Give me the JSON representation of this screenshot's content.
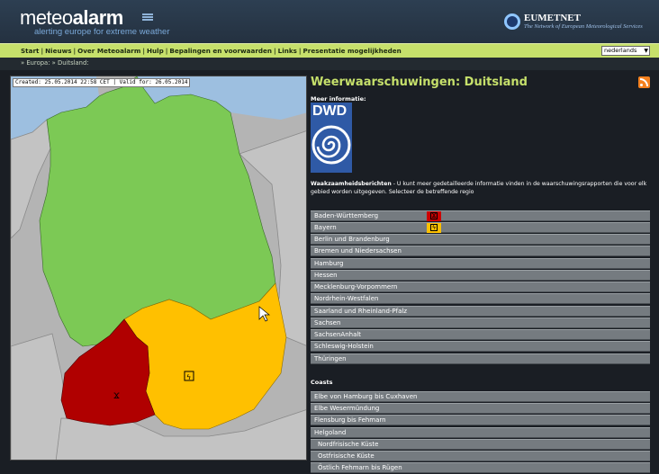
{
  "header": {
    "logo_light": "meteo",
    "logo_bold": "alarm",
    "tagline": "alerting europe for extreme weather",
    "partner_name": "EUMETNET",
    "partner_sub": "The Network of European Meteorological Services"
  },
  "nav": {
    "items": [
      {
        "label": "Start"
      },
      {
        "label": "Nieuws"
      },
      {
        "label": "Over Meteoalarm"
      },
      {
        "label": "Hulp"
      },
      {
        "label": "Bepalingen en voorwaarden"
      },
      {
        "label": "Links"
      },
      {
        "label": "Presentatie mogelijkheden"
      }
    ],
    "separator": "|",
    "language": "nederlands"
  },
  "breadcrumb": "» Europa: » Duitsland:",
  "map": {
    "caption": "Created: 25.05.2014 22:58 CET | Valid for: 26.05.2014",
    "colors": {
      "green": "#7cc955",
      "yellow": "#ffc000",
      "red": "#b00000",
      "sea": "#9dbfe0",
      "neighbor": "#c3c3c3"
    }
  },
  "main": {
    "title": "Weerwaarschuwingen: Duitsland",
    "more_info_label": "Meer informatie:",
    "dwd_label": "DWD",
    "desc_bold": "Waakzaamheidsberichten",
    "desc_text": " - U kunt meer gedetailleerde informatie vinden in de waarschuwingsrapporten die voor elk gebied worden uitgegeven. Selecteer de betreffende regio",
    "regions": [
      {
        "label": "Baden-Württemberg",
        "warning": "red"
      },
      {
        "label": "Bayern",
        "warning": "orange"
      },
      {
        "label": "Berlin und Brandenburg",
        "warning": ""
      },
      {
        "label": "Bremen und Niedersachsen",
        "warning": ""
      },
      {
        "label": "Hamburg",
        "warning": ""
      },
      {
        "label": "Hessen",
        "warning": ""
      },
      {
        "label": "Mecklenburg-Vorpommern",
        "warning": ""
      },
      {
        "label": "Nordrhein-Westfalen",
        "warning": ""
      },
      {
        "label": "Saarland und Rheinland-Pfalz",
        "warning": ""
      },
      {
        "label": "Sachsen",
        "warning": ""
      },
      {
        "label": "SachsenAnhalt",
        "warning": ""
      },
      {
        "label": "Schleswig-Holstein",
        "warning": ""
      },
      {
        "label": "Thüringen",
        "warning": ""
      }
    ],
    "coasts_label": "Coasts",
    "coasts": [
      {
        "label": "Elbe von Hamburg bis Cuxhaven"
      },
      {
        "label": "Elbe Wesermündung"
      },
      {
        "label": "Flensburg bis Fehmarn"
      },
      {
        "label": "Helgoland"
      },
      {
        "label": "Nordfrisische Küste"
      },
      {
        "label": "Ostfrisische Küste"
      },
      {
        "label": "Östlich Fehmarn bis Rügen"
      }
    ]
  }
}
